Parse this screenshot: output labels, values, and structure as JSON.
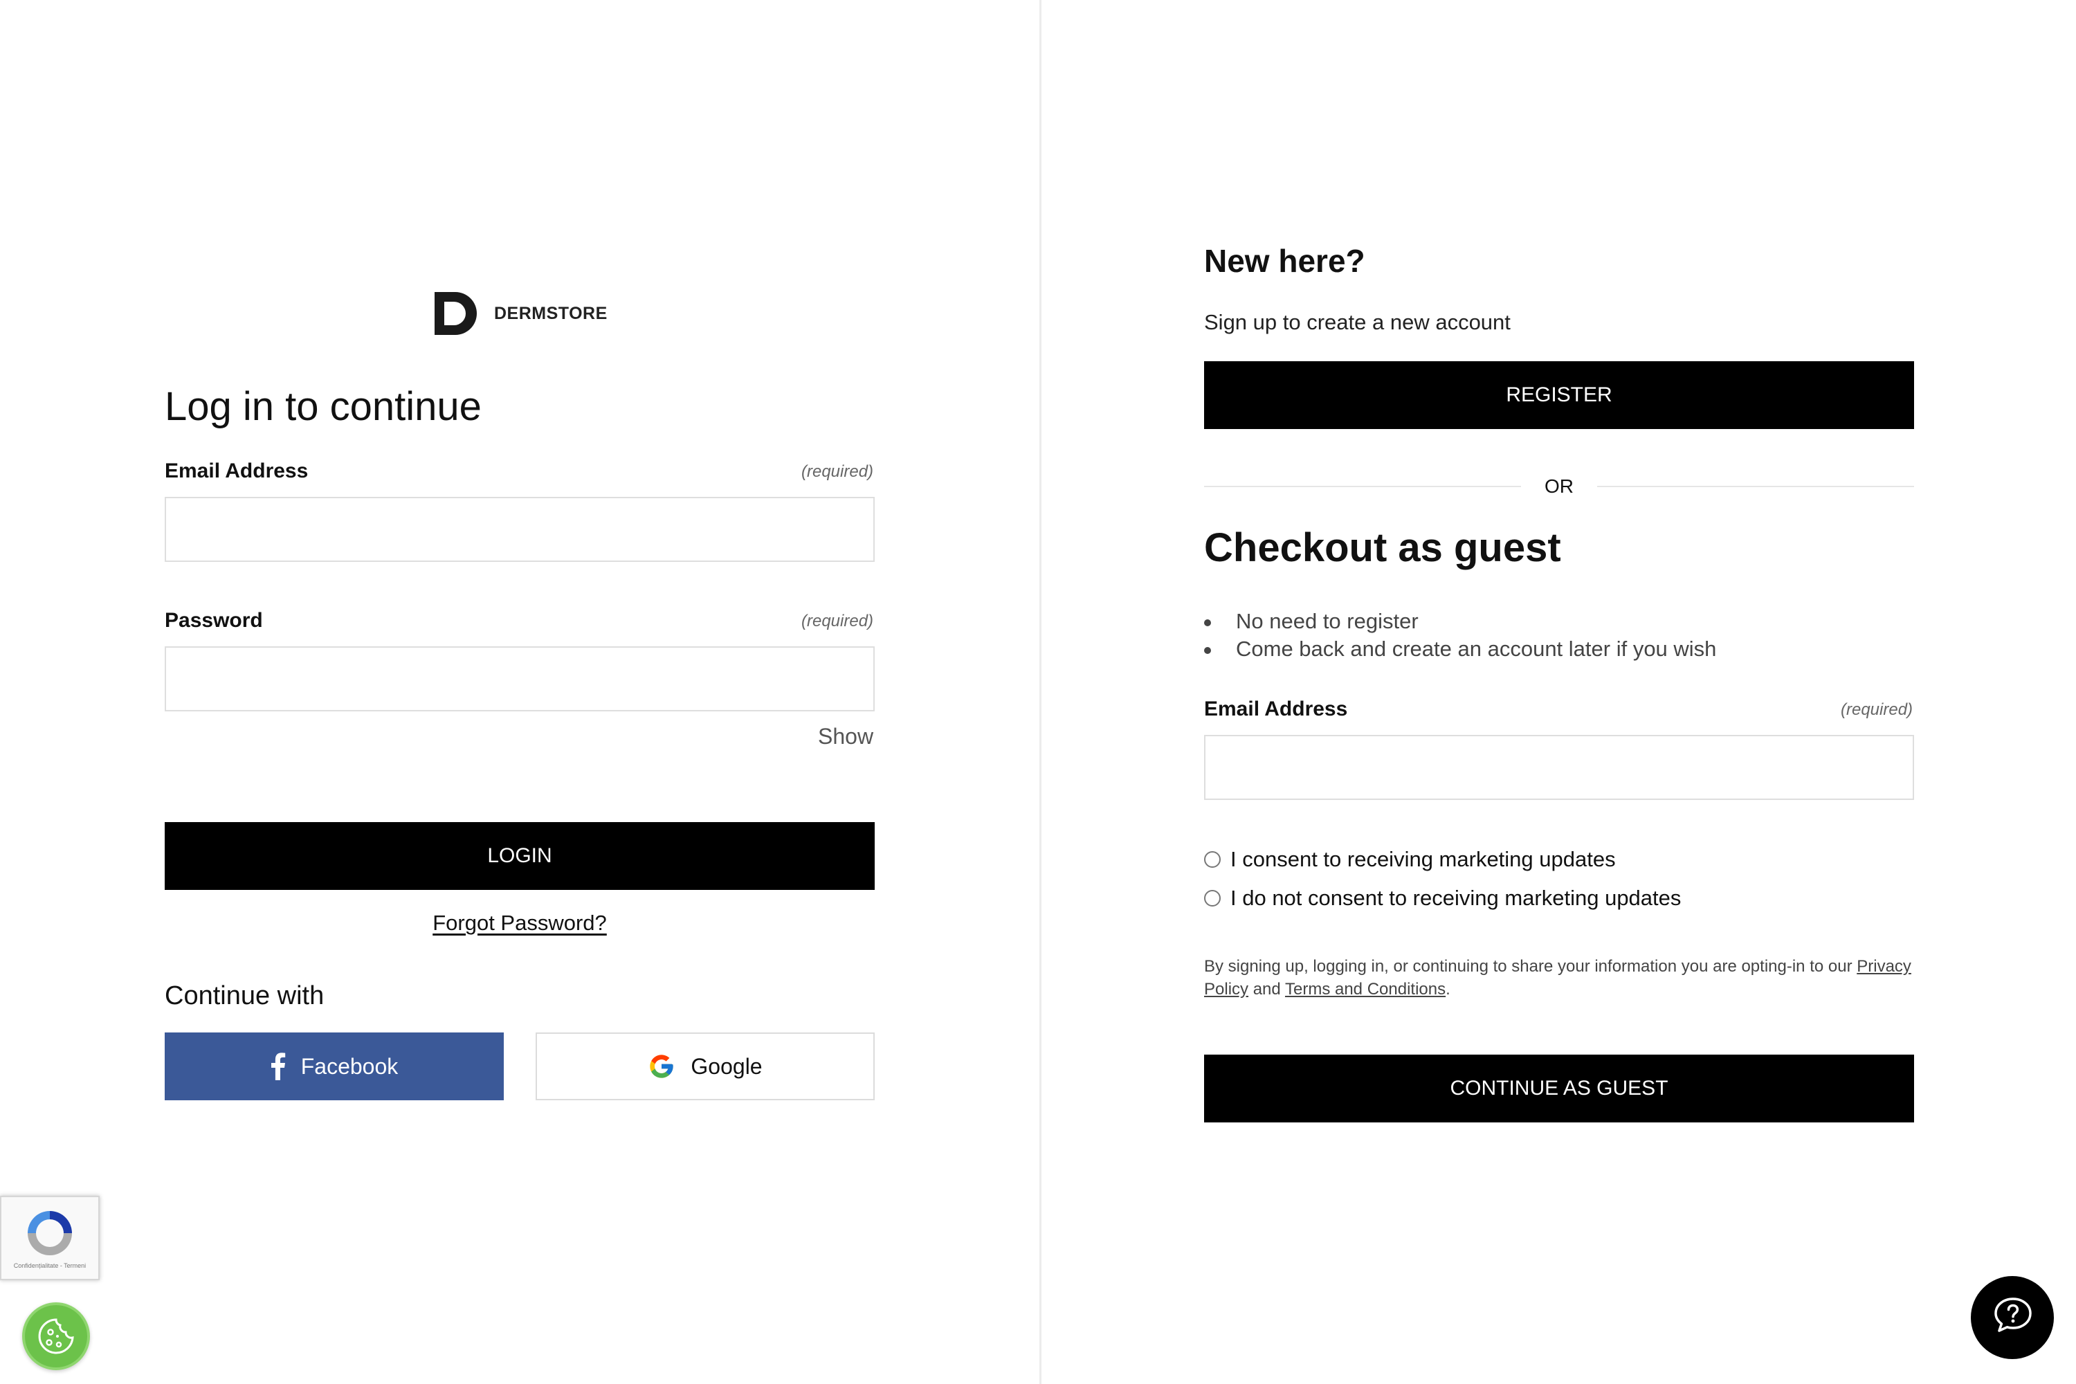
{
  "brand": {
    "name": "DERMSTORE",
    "logo_icon": "dermstore-d-logo-icon"
  },
  "login": {
    "heading": "Log in to continue",
    "email_label": "Email Address",
    "email_required": "(required)",
    "email_value": "",
    "password_label": "Password",
    "password_required": "(required)",
    "password_value": "",
    "show_label": "Show",
    "login_button": "LOGIN",
    "forgot_link": "Forgot Password?",
    "continue_with": "Continue with",
    "facebook_label": "Facebook",
    "google_label": "Google"
  },
  "register": {
    "heading": "New here?",
    "subtext": "Sign up to create a new account",
    "register_button": "REGISTER"
  },
  "divider": {
    "or_text": "OR"
  },
  "guest": {
    "heading": "Checkout as guest",
    "bullets": [
      "No need to register",
      "Come back and create an account later if you wish"
    ],
    "email_label": "Email Address",
    "email_required": "(required)",
    "email_value": "",
    "consent_yes": "I consent to receiving marketing updates",
    "consent_no": "I do not consent to receiving marketing updates",
    "legal_prefix": "By signing up, logging in, or continuing to share your information you are opting-in to our ",
    "privacy_link": "Privacy Policy",
    "legal_and": " and ",
    "terms_link": "Terms and Conditions",
    "legal_suffix": ".",
    "continue_button": "CONTINUE AS GUEST"
  },
  "widgets": {
    "recaptcha_text": "Confidențialitate - Termeni",
    "recaptcha_icon": "recaptcha-icon",
    "cookie_icon": "cookie-icon",
    "help_icon": "help-chat-icon"
  },
  "colors": {
    "primary_button": "#000000",
    "facebook": "#3b5998",
    "cookie_button": "#6cc24a"
  }
}
